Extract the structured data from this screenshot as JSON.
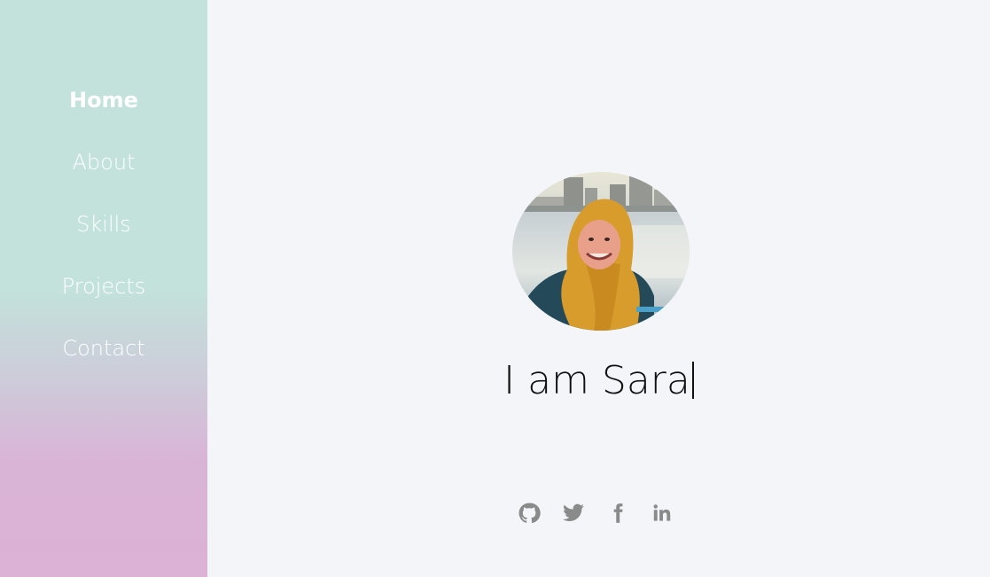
{
  "sidebar": {
    "items": [
      {
        "label": "Home",
        "active": true
      },
      {
        "label": "About",
        "active": false
      },
      {
        "label": "Skills",
        "active": false
      },
      {
        "label": "Projects",
        "active": false
      },
      {
        "label": "Contact",
        "active": false
      }
    ]
  },
  "hero": {
    "headline": "I am Sara"
  },
  "social": [
    {
      "icon": "github-icon"
    },
    {
      "icon": "twitter-icon"
    },
    {
      "icon": "facebook-icon"
    },
    {
      "icon": "linkedin-icon"
    }
  ],
  "colors": {
    "sidebar_top": "#c3e2db",
    "sidebar_bottom": "#dcb2d6",
    "background": "#f3f5f9",
    "social_icon": "#8a8a8a"
  }
}
